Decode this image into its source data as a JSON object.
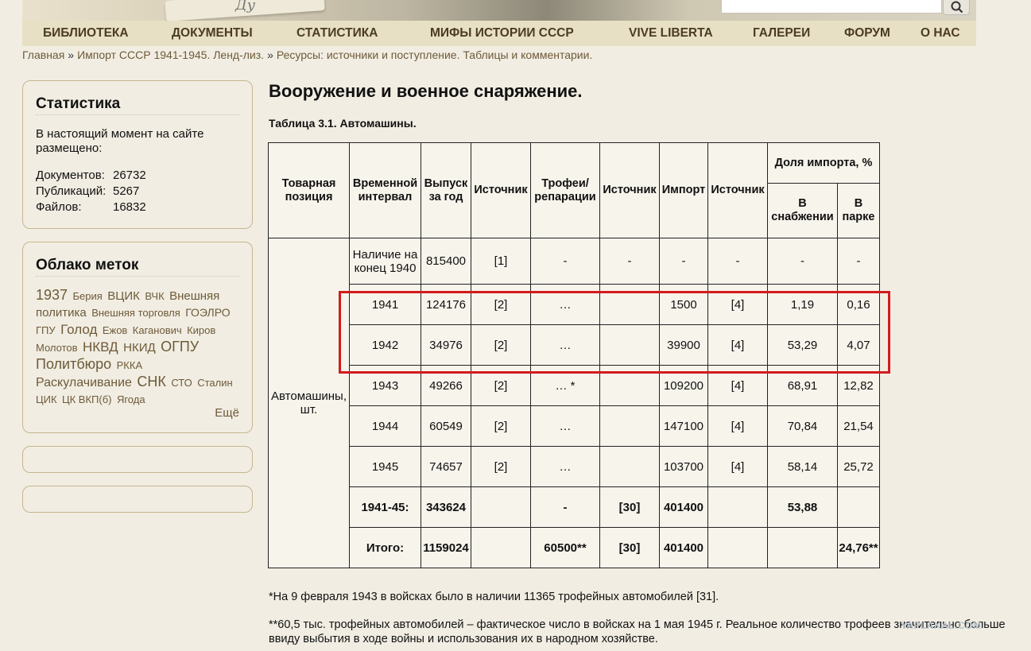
{
  "header": {
    "banner_scrawl": "Ду"
  },
  "nav": {
    "items": [
      "БИБЛИОТЕКА",
      "ДОКУМЕНТЫ",
      "СТАТИСТИКА",
      "МИФЫ ИСТОРИИ СССР",
      "VIVE LIBERTA",
      "ГАЛЕРЕИ",
      "ФОРУМ",
      "О НАС"
    ]
  },
  "breadcrumb": {
    "items": [
      "Главная",
      "Импорт СССР 1941-1945. Ленд-лиз.",
      "Ресурсы: источники и поступление. Таблицы и комментарии."
    ],
    "separator": "»"
  },
  "stats_box": {
    "title": "Статистика",
    "intro": "В настоящий момент на сайте размещено:",
    "rows": [
      {
        "label": "Документов:",
        "value": "26732"
      },
      {
        "label": "Публикаций:",
        "value": "5267"
      },
      {
        "label": "Файлов:",
        "value": "16832"
      }
    ]
  },
  "tag_cloud": {
    "title": "Облако меток",
    "more": "Ещё",
    "tags": [
      {
        "text": "1937",
        "size": 18
      },
      {
        "text": "Берия",
        "size": 13
      },
      {
        "text": "ВЦИК",
        "size": 15
      },
      {
        "text": "ВЧК",
        "size": 13
      },
      {
        "text": "Внешняя политика",
        "size": 15
      },
      {
        "text": "Внешняя торговля",
        "size": 13
      },
      {
        "text": "ГОЭЛРО",
        "size": 14
      },
      {
        "text": "ГПУ",
        "size": 13
      },
      {
        "text": "Голод",
        "size": 17
      },
      {
        "text": "Ежов",
        "size": 13
      },
      {
        "text": "Каганович",
        "size": 13
      },
      {
        "text": "Киров",
        "size": 13
      },
      {
        "text": "Молотов",
        "size": 13
      },
      {
        "text": "НКВД",
        "size": 17
      },
      {
        "text": "НКИД",
        "size": 15
      },
      {
        "text": "ОГПУ",
        "size": 18
      },
      {
        "text": "Политбюро",
        "size": 18
      },
      {
        "text": "РККА",
        "size": 13
      },
      {
        "text": "Раскулачивание",
        "size": 16
      },
      {
        "text": "СНК",
        "size": 18
      },
      {
        "text": "СТО",
        "size": 13
      },
      {
        "text": "Сталин",
        "size": 13
      },
      {
        "text": "ЦИК",
        "size": 13
      },
      {
        "text": "ЦК ВКП(б)",
        "size": 13
      },
      {
        "text": "Ягода",
        "size": 13
      }
    ]
  },
  "main": {
    "title": "Вооружение и военное снаряжение.",
    "caption": "Таблица 3.1. Автомашины.",
    "table": {
      "headers": {
        "position": "Товарная позиция",
        "interval": "Временной интервал",
        "output": "Выпуск за год",
        "source1": "Источник",
        "trophies": "Трофеи/ репарации",
        "source2": "Источник",
        "import": "Импорт",
        "source3": "Источник",
        "share": "Доля импорта, %",
        "share_supply": "В снабжении",
        "share_park": "В парке"
      },
      "position_label": "Автомашины, шт.",
      "rows": [
        {
          "interval": "Наличие на конец 1940",
          "output": "815400",
          "src1": "[1]",
          "trophies": "-",
          "src2": "-",
          "import": "-",
          "src3": "-",
          "supply": "-",
          "park": "-",
          "bold": false
        },
        {
          "interval": "1941",
          "output": "124176",
          "src1": "[2]",
          "trophies": "…",
          "src2": "",
          "import": "1500",
          "src3": "[4]",
          "supply": "1,19",
          "park": "0,16",
          "bold": false
        },
        {
          "interval": "1942",
          "output": "34976",
          "src1": "[2]",
          "trophies": "…",
          "src2": "",
          "import": "39900",
          "src3": "[4]",
          "supply": "53,29",
          "park": "4,07",
          "bold": false
        },
        {
          "interval": "1943",
          "output": "49266",
          "src1": "[2]",
          "trophies": "… *",
          "src2": "",
          "import": "109200",
          "src3": "[4]",
          "supply": "68,91",
          "park": "12,82",
          "bold": false
        },
        {
          "interval": "1944",
          "output": "60549",
          "src1": "[2]",
          "trophies": "…",
          "src2": "",
          "import": "147100",
          "src3": "[4]",
          "supply": "70,84",
          "park": "21,54",
          "bold": false
        },
        {
          "interval": "1945",
          "output": "74657",
          "src1": "[2]",
          "trophies": "…",
          "src2": "",
          "import": "103700",
          "src3": "[4]",
          "supply": "58,14",
          "park": "25,72",
          "bold": false
        },
        {
          "interval": "1941-45:",
          "output": "343624",
          "src1": "",
          "trophies": "-",
          "src2": "[30]",
          "import": "401400",
          "src3": "",
          "supply": "53,88",
          "park": "",
          "bold": true
        },
        {
          "interval": "Итого:",
          "output": "1159024",
          "src1": "",
          "trophies": "60500**",
          "src2": "[30]",
          "import": "401400",
          "src3": "",
          "supply": "",
          "park": "24,76**",
          "bold": true
        }
      ]
    },
    "footnotes": [
      "*На 9 февраля 1943 в войсках было в наличии 11365 трофейных автомобилей [31].",
      "**60,5 тыс. трофейных автомобилей – фактическое число в войсках на 1 мая 1945 г. Реальное количество трофеев значительно больше ввиду выбытия в ходе войны и использования их в народном хозяйстве."
    ],
    "watermark": "YAPLAKAL.COM"
  },
  "colors": {
    "background": "#f1ede2",
    "nav_bg": "#e8e0c4",
    "nav_text": "#4a3c24",
    "link": "#6e5a3a",
    "highlight_border": "#d31b1b"
  }
}
